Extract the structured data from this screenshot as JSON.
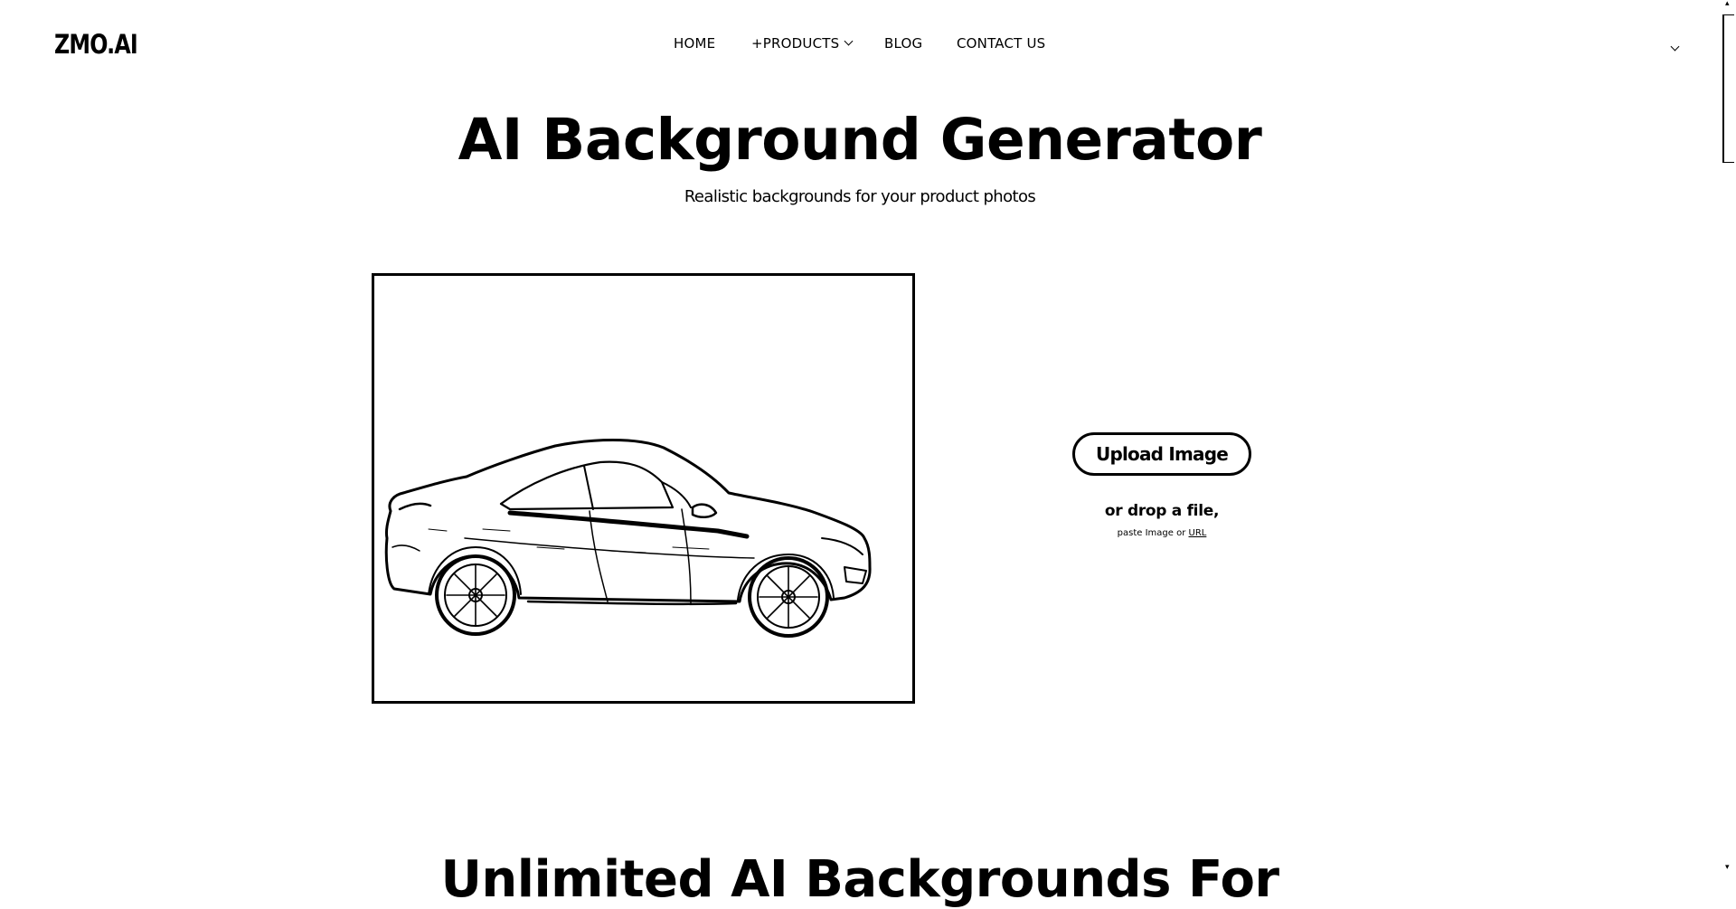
{
  "header": {
    "logo": "ZMO.AI",
    "nav": {
      "home": "HOME",
      "products": "+PRODUCTS",
      "blog": "BLOG",
      "contact": "CONTACT US"
    }
  },
  "hero": {
    "title": "AI Background Generator",
    "subtitle": "Realistic backgrounds for your product photos"
  },
  "upload": {
    "button_label": "Upload Image",
    "drop_text": "or drop a file,",
    "paste_text": "paste Image or",
    "url_text": "URL"
  },
  "sample_image": {
    "subject": "car-icon"
  },
  "next_section": {
    "heading": "Unlimited AI Backgrounds For"
  },
  "icons": {
    "products_chevron": "chevron-down-icon",
    "account_chevron": "chevron-down-icon"
  },
  "colors": {
    "text": "#000000",
    "background": "#ffffff"
  }
}
